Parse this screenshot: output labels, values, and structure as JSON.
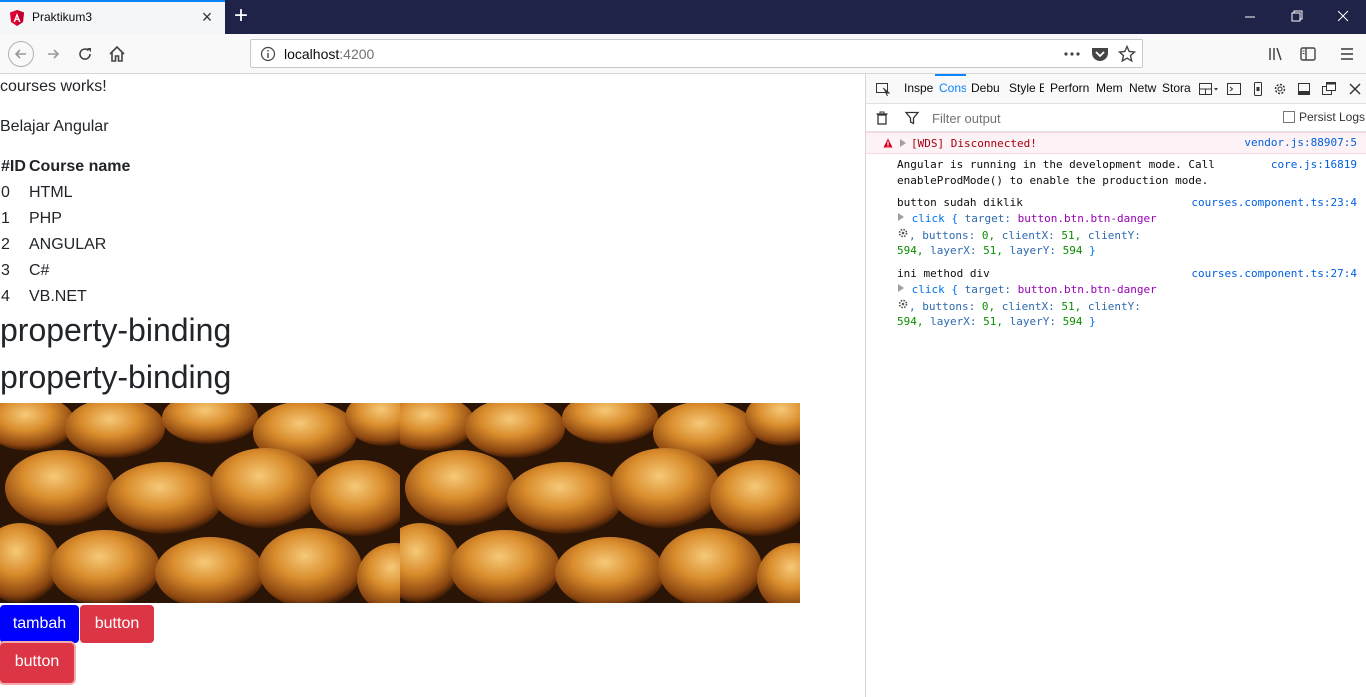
{
  "browser": {
    "tab_title": "Praktikum3",
    "url_host": "localhost",
    "url_port": ":4200",
    "accent_color": "#0a84ff",
    "titlebar_color": "#1f2347"
  },
  "page": {
    "works_text": "courses works!",
    "subtitle": "Belajar Angular",
    "table_headers": [
      "#ID",
      "Course name"
    ],
    "courses": [
      {
        "id": "0",
        "name": "HTML"
      },
      {
        "id": "1",
        "name": "PHP"
      },
      {
        "id": "2",
        "name": "ANGULAR"
      },
      {
        "id": "3",
        "name": "C#"
      },
      {
        "id": "4",
        "name": "VB.NET"
      }
    ],
    "headings": [
      "property-binding",
      "property-binding"
    ],
    "buttons": {
      "tambah": "tambah",
      "button1": "button",
      "button2": "button"
    },
    "colors": {
      "primary_blue": "#0000ff",
      "danger_red": "#dc3545"
    }
  },
  "devtools": {
    "tabs": [
      "Inspe",
      "Cons",
      "Debu",
      "Style E",
      "Perforn",
      "Mem",
      "Netw",
      "Stora"
    ],
    "active_tab": "Cons",
    "filter_placeholder": "Filter output",
    "persist_logs": "Persist Logs",
    "logs": {
      "error_msg": "[WDS] Disconnected!",
      "error_src": "vendor.js:88907:5",
      "info1_line1": "Angular is running in the development mode. Call",
      "info1_line2": "enableProdMode() to enable the production mode.",
      "info1_src": "core.js:16819",
      "log2_title": "button sudah diklik",
      "log2_src": "courses.component.ts:23:4",
      "log3_title": "ini method div",
      "log3_src": "courses.component.ts:27:4",
      "evt_click": "click",
      "evt_target_key": "target:",
      "evt_target_val": "button.btn.btn-danger",
      "evt_buttons_key": "buttons:",
      "evt_buttons_val": "0,",
      "evt_clientx_key": "clientX:",
      "evt_clientx_val": "51,",
      "evt_clienty_key": "clientY:",
      "evt_clienty_val": "594,",
      "evt_layerx_key": "layerX:",
      "evt_layerx_val": "51,",
      "evt_layery_key": "layerY:",
      "evt_layery_val": "594"
    }
  }
}
